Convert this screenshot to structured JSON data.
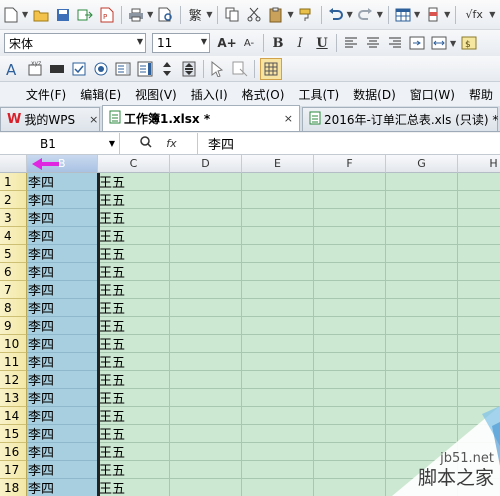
{
  "toolbar1": {
    "font_traditional": "繁",
    "formula_label": "√fx"
  },
  "toolbar2": {
    "font_name": "宋体",
    "font_size": "11",
    "bold": "B",
    "italic": "I",
    "underline": "U",
    "grow_font": "A+",
    "shrink_font": "A-"
  },
  "menu": [
    "文件(F)",
    "编辑(E)",
    "视图(V)",
    "插入(I)",
    "格式(O)",
    "工具(T)",
    "数据(D)",
    "窗口(W)",
    "帮助"
  ],
  "tabs": [
    {
      "label": "我的WPS",
      "close": "×"
    },
    {
      "label": "工作簿1.xlsx *",
      "close": "×"
    },
    {
      "label": "2016年-订单汇总表.xls (只读) *",
      "close": ""
    }
  ],
  "formula_bar": {
    "name_box": "B1",
    "fx": "fx",
    "content": "李四"
  },
  "grid": {
    "columns": [
      "B",
      "C",
      "D",
      "E",
      "F",
      "G",
      "H"
    ],
    "rows": [
      {
        "n": "1",
        "b": "李四",
        "c": "王五"
      },
      {
        "n": "2",
        "b": "李四",
        "c": "王五"
      },
      {
        "n": "3",
        "b": "李四",
        "c": "王五"
      },
      {
        "n": "4",
        "b": "李四",
        "c": "王五"
      },
      {
        "n": "5",
        "b": "李四",
        "c": "王五"
      },
      {
        "n": "6",
        "b": "李四",
        "c": "王五"
      },
      {
        "n": "7",
        "b": "李四",
        "c": "王五"
      },
      {
        "n": "8",
        "b": "李四",
        "c": "王五"
      },
      {
        "n": "9",
        "b": "李四",
        "c": "王五"
      },
      {
        "n": "10",
        "b": "李四",
        "c": "王五"
      },
      {
        "n": "11",
        "b": "李四",
        "c": "王五"
      },
      {
        "n": "12",
        "b": "李四",
        "c": "王五"
      },
      {
        "n": "13",
        "b": "李四",
        "c": "王五"
      },
      {
        "n": "14",
        "b": "李四",
        "c": "王五"
      },
      {
        "n": "15",
        "b": "李四",
        "c": "王五"
      },
      {
        "n": "16",
        "b": "李四",
        "c": "王五"
      },
      {
        "n": "17",
        "b": "李四",
        "c": "王五"
      },
      {
        "n": "18",
        "b": "李四",
        "c": "王五"
      }
    ]
  },
  "watermark": {
    "site": "jb51.net",
    "name": "脚本之家"
  },
  "colors": {
    "selected_column": "#a8cfe0",
    "grid_green": "#cde8d2",
    "arrow": "#e026e0",
    "wps_red": "#d9202a"
  }
}
